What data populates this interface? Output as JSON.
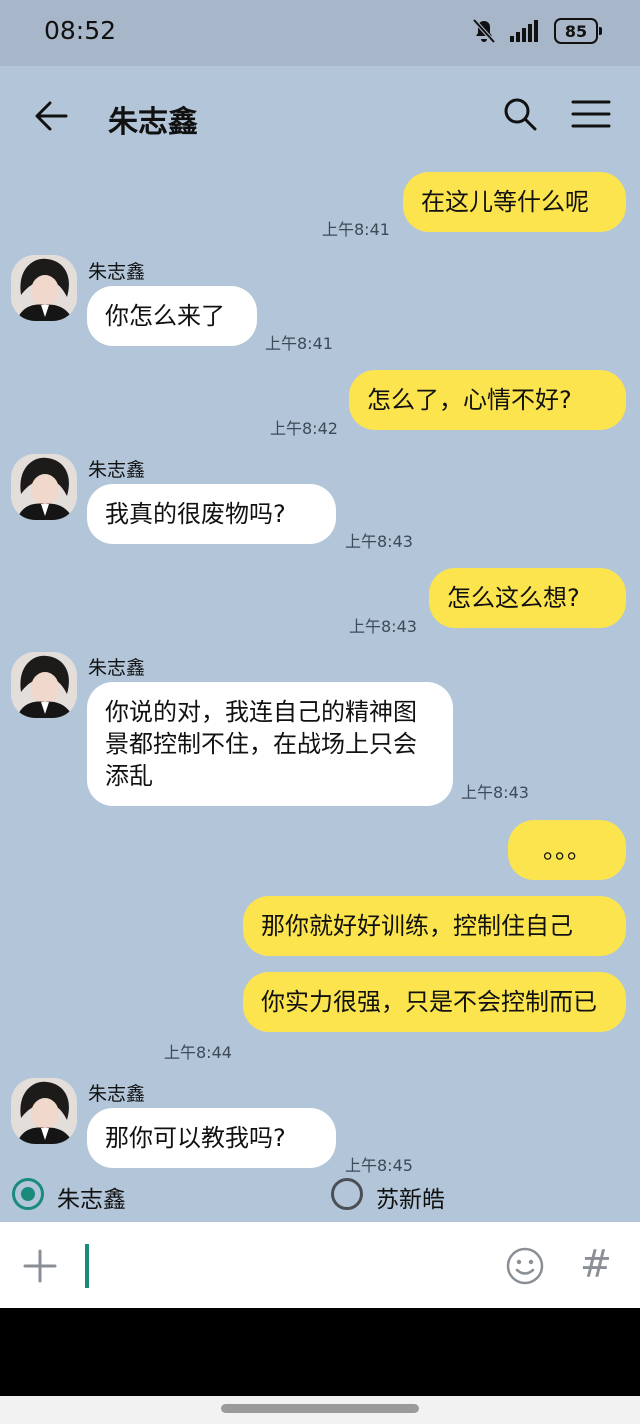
{
  "status_bar": {
    "time": "08:52",
    "battery": "85"
  },
  "header": {
    "title": "朱志鑫"
  },
  "messages": [
    {
      "text": "在这儿等什么呢",
      "time": "上午8:41"
    },
    {
      "sender": "朱志鑫",
      "text": "你怎么来了",
      "time": "上午8:41"
    },
    {
      "text": "怎么了，心情不好?",
      "time": "上午8:42"
    },
    {
      "sender": "朱志鑫",
      "text": "我真的很废物吗?",
      "time": "上午8:43"
    },
    {
      "text": "怎么这么想?",
      "time": "上午8:43"
    },
    {
      "sender": "朱志鑫",
      "text": "你说的对，我连自己的精神图景都控制不住，在战场上只会添乱",
      "time": "上午8:43"
    },
    {
      "text": "。。。"
    },
    {
      "text": "那你就好好训练，控制住自己"
    },
    {
      "text": "你实力很强，只是不会控制而已",
      "time": "上午8:44"
    },
    {
      "sender": "朱志鑫",
      "text": "那你可以教我吗?",
      "time": "上午8:45"
    }
  ],
  "personas": [
    {
      "name": "朱志鑫",
      "selected": true
    },
    {
      "name": "苏新皓",
      "selected": false
    }
  ],
  "colors": {
    "accent": "#1a8a7a",
    "my_bubble": "#fbe44d",
    "background": "#b3c6d9"
  }
}
